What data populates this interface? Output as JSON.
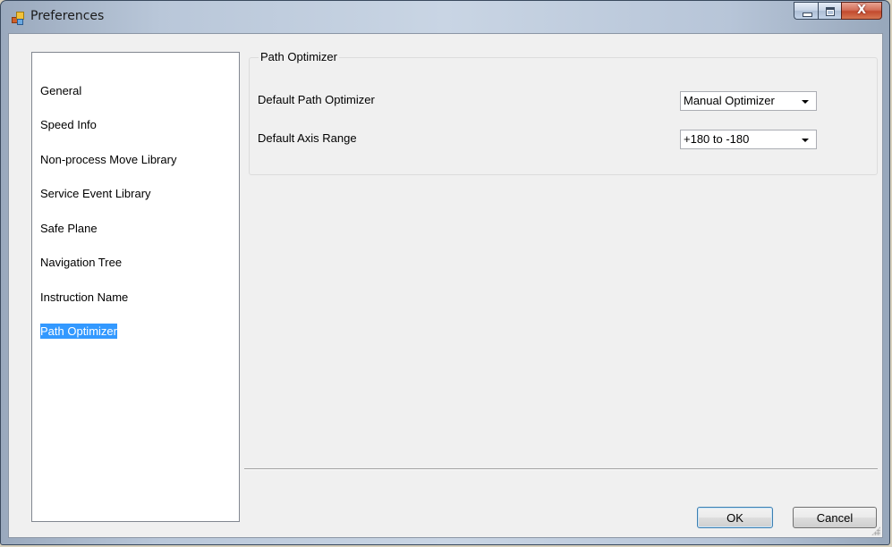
{
  "window": {
    "title": "Preferences",
    "minimize_icon": "minimize-icon",
    "maximize_icon": "maximize-icon",
    "close_label": "X"
  },
  "categories": {
    "items": [
      {
        "label": "General",
        "selected": false
      },
      {
        "label": "Speed Info",
        "selected": false
      },
      {
        "label": "Non-process Move Library",
        "selected": false
      },
      {
        "label": "Service Event Library",
        "selected": false
      },
      {
        "label": "Safe Plane",
        "selected": false
      },
      {
        "label": "Navigation Tree",
        "selected": false
      },
      {
        "label": "Instruction Name",
        "selected": false
      },
      {
        "label": "Path Optimizer",
        "selected": true
      }
    ]
  },
  "panel": {
    "group_title": "Path Optimizer",
    "fields": [
      {
        "label": "Default Path Optimizer",
        "value": "Manual Optimizer"
      },
      {
        "label": "Default Axis Range",
        "value": "+180 to -180"
      }
    ]
  },
  "buttons": {
    "ok": "OK",
    "cancel": "Cancel"
  },
  "colors": {
    "selection": "#3399ff",
    "dialog_background": "#f0f0f0",
    "close_button": "#c34a2e"
  }
}
